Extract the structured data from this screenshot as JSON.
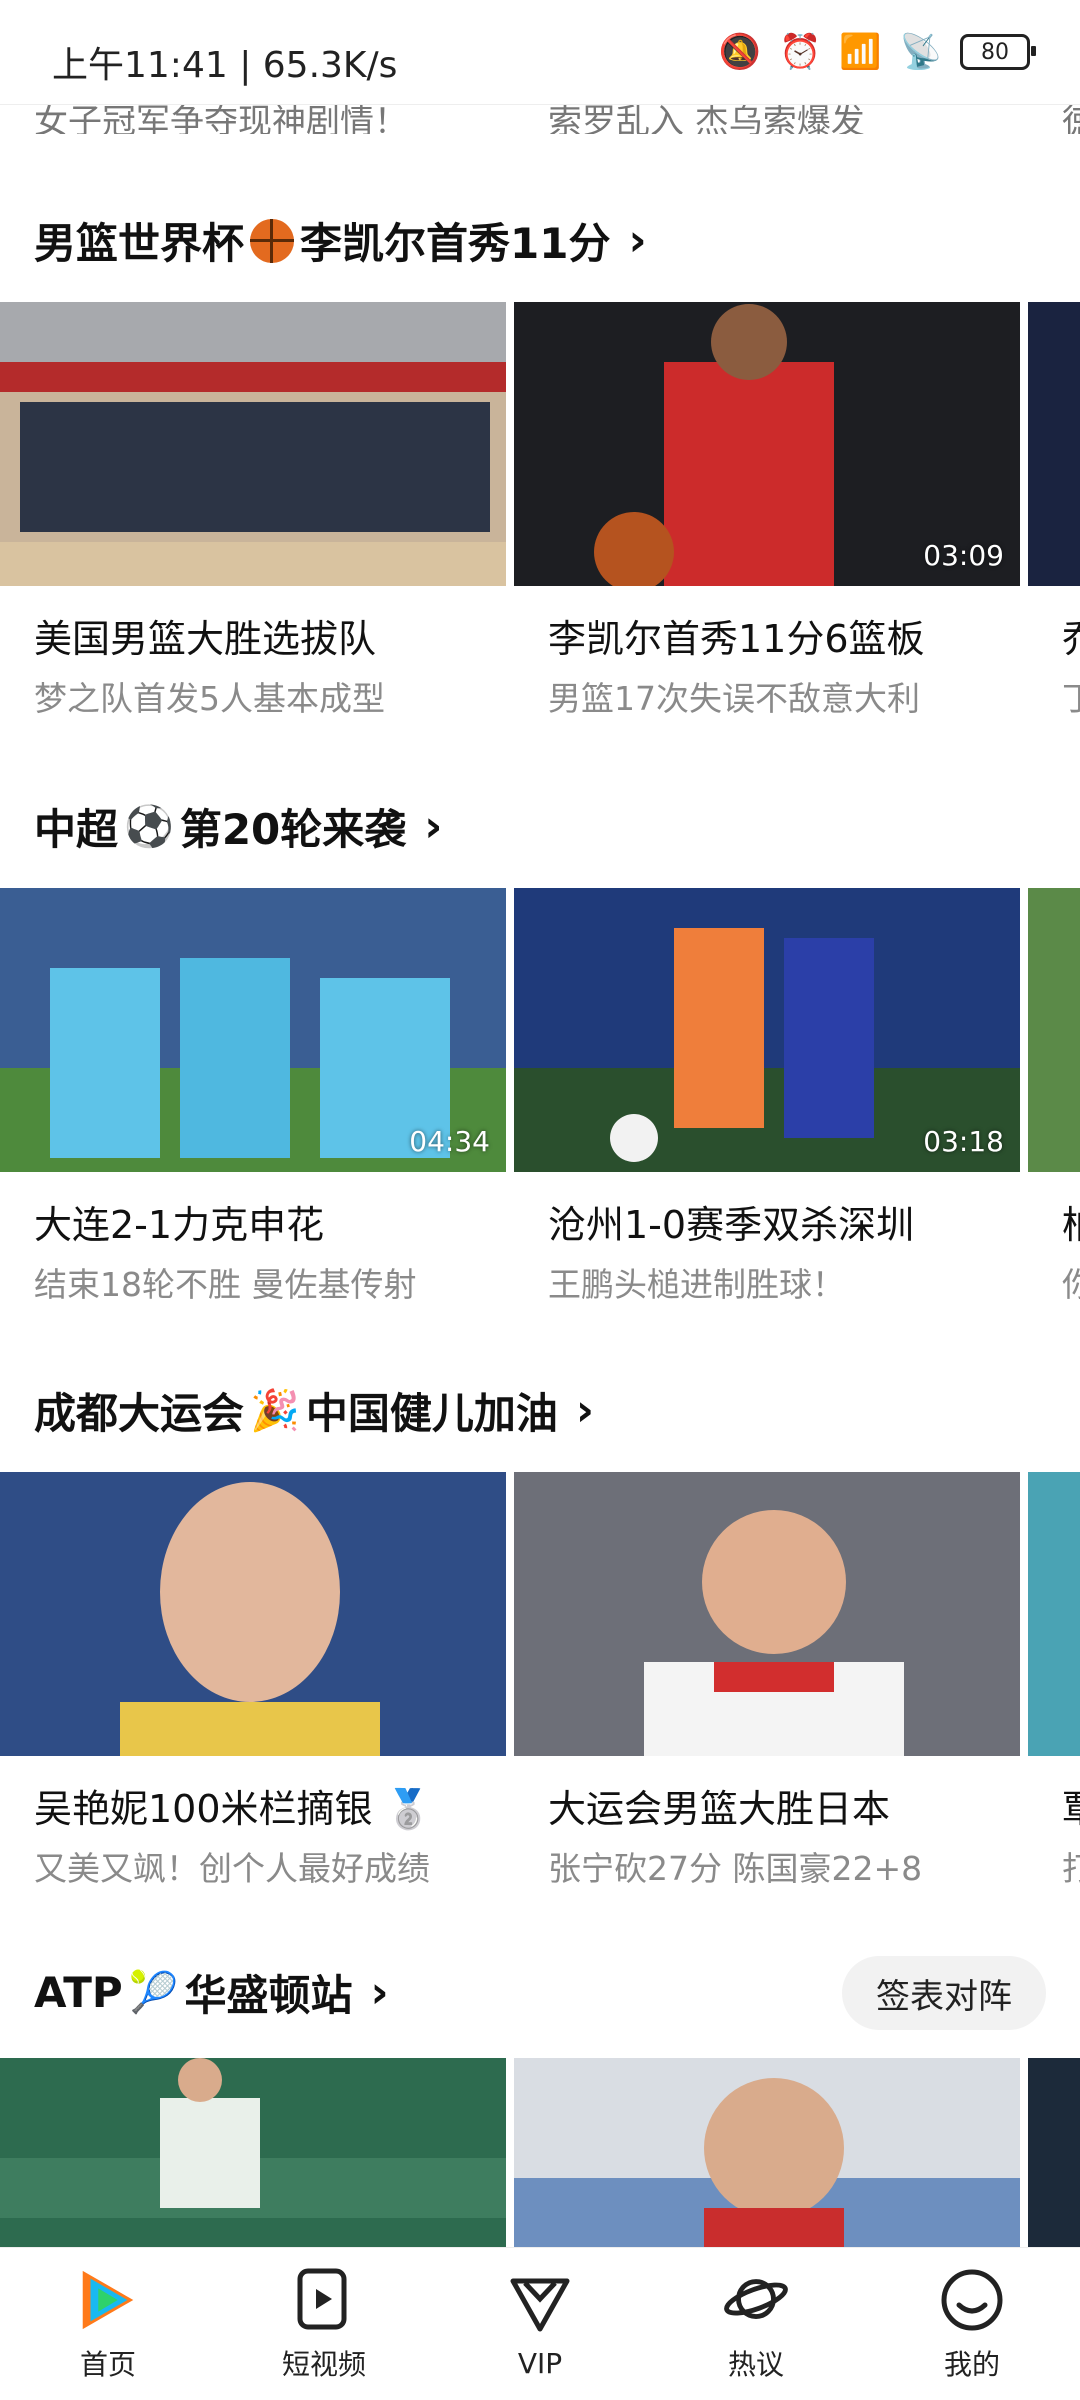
{
  "status_bar": {
    "time": "上午11:41 | 65.3K/s",
    "battery": "80"
  },
  "prev_row": {
    "items": [
      "女子冠军争夺现神剧情！",
      "索罗乱入 杰乌索爆发",
      "徳"
    ]
  },
  "sections": [
    {
      "title": "男篮世界杯",
      "title_after": "李凯尔首秀11分",
      "cards": [
        {
          "title": "美国男篮大胜选拔队",
          "subtitle": "梦之队首发5人基本成型",
          "duration": ""
        },
        {
          "title": "李凯尔首秀11分6篮板",
          "subtitle": "男篮17次失误不敌意大利",
          "duration": "03:09"
        },
        {
          "title": "乔",
          "subtitle": "丁",
          "duration": ""
        }
      ]
    },
    {
      "title": "中超",
      "title_after": "第20轮来袭",
      "cards": [
        {
          "title": "大连2-1力克申花",
          "subtitle": "结束18轮不胜 曼佐基传射",
          "duration": "04:34"
        },
        {
          "title": "沧州1-0赛季双杀深圳",
          "subtitle": "王鹏头槌进制胜球！",
          "duration": "03:18"
        },
        {
          "title": "柏",
          "subtitle": "你",
          "duration": ""
        }
      ]
    },
    {
      "title": "成都大运会",
      "title_after": "中国健儿加油",
      "cards": [
        {
          "title": "吴艳妮100米栏摘银",
          "subtitle": "又美又飒！创个人最好成绩",
          "duration": ""
        },
        {
          "title": "大运会男篮大胜日本",
          "subtitle": "张宁砍27分 陈国豪22+8",
          "duration": ""
        },
        {
          "title": "覃",
          "subtitle": "打",
          "duration": ""
        }
      ]
    },
    {
      "title": "ATP",
      "title_after": "华盛顿站",
      "button": "签表对阵"
    }
  ],
  "bottom_nav": [
    {
      "label": "首页"
    },
    {
      "label": "短视频"
    },
    {
      "label": "VIP"
    },
    {
      "label": "热议"
    },
    {
      "label": "我的"
    }
  ]
}
